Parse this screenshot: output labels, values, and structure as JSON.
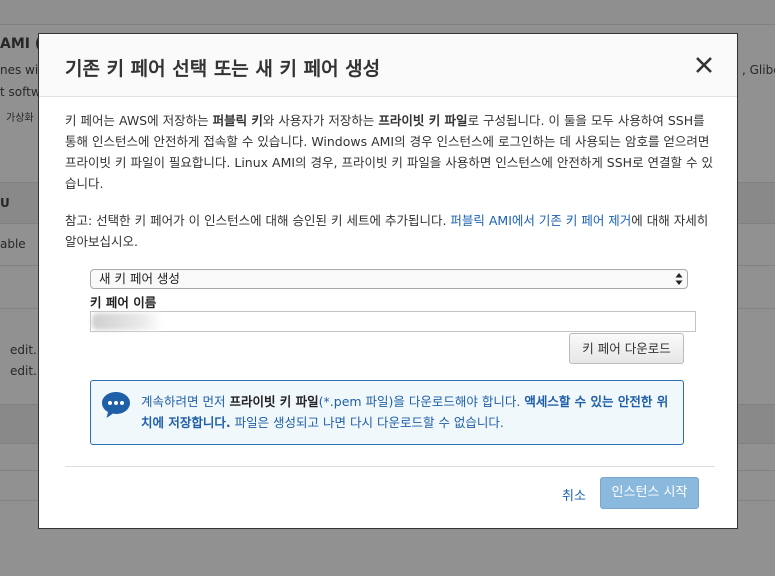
{
  "background": {
    "texts": [
      "AMI (",
      "nes wit",
      "t softw",
      "가상화",
      "U",
      "able",
      "edit.",
      "edit.",
      ", Glibc"
    ]
  },
  "modal": {
    "title": "기존 키 페어 선택 또는 새 키 페어 생성",
    "close_icon": "close-icon",
    "para1": {
      "t1": "키 페어는 AWS에 저장하는 ",
      "b1": "퍼블릭 키",
      "t2": "와 사용자가 저장하는 ",
      "b2": "프라이빗 키 파일",
      "t3": "로 구성됩니다. 이 둘을 모두 사용하여 SSH를 통해 인스턴스에 안전하게 접속할 수 있습니다. Windows AMI의 경우 인스턴스에 로그인하는 데 사용되는 암호를 얻으려면 프라이빗 키 파일이 필요합니다. Linux AMI의 경우, 프라이빗 키 파일을 사용하면 인스턴스에 안전하게 SSH로 연결할 수 있습니다."
    },
    "para2": {
      "t1": "참고: 선택한 키 페어가 이 인스턴스에 대해 승인된 키 세트에 추가됩니다. ",
      "link": "퍼블릭 AMI에서 기존 키 페어 제거",
      "t2": "에 대해 자세히 알아보십시오."
    },
    "select_value": "새 키 페어 생성",
    "key_pair_name_label": "키 페어 이름",
    "key_pair_name_value": "",
    "download_button": "키 페어 다운로드",
    "info": {
      "icon": "chat-bubble-icon",
      "t1": "계속하려면 먼저 ",
      "b1": "프라이빗 키 파일",
      "t2": "(*.pem 파일)을 다운로드해야 합니다. ",
      "b2": "액세스할 수 있는 안전한 위치에 저장합니다.",
      "t3": " 파일은 생성되고 나면 다시 다운로드할 수 없습니다."
    },
    "cancel_label": "취소",
    "launch_label": "인스턴스 시작"
  },
  "colors": {
    "link": "#1a62b5",
    "info_border": "#2b6fb6",
    "launch_bg": "#8bb8dd"
  }
}
